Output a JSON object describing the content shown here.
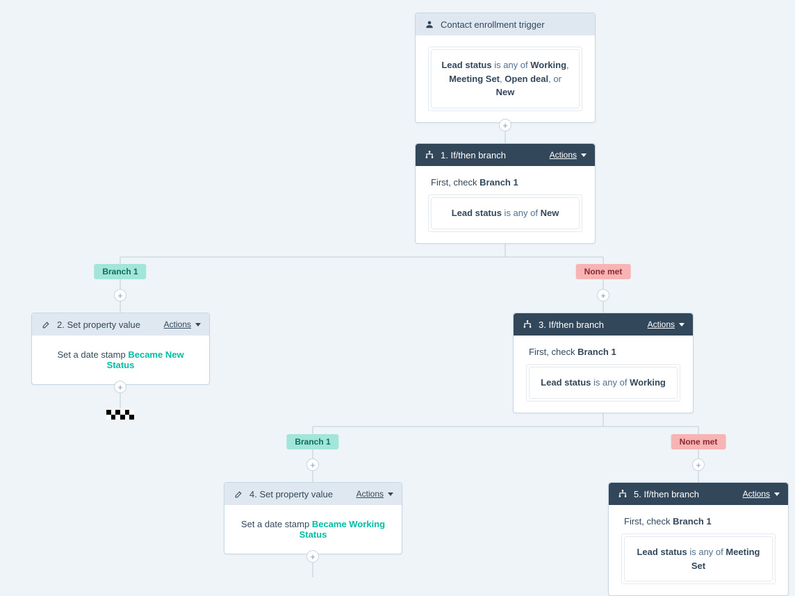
{
  "actions_label": "Actions",
  "trigger": {
    "title": "Contact enrollment trigger",
    "prop": "Lead status",
    "mid": " is any of ",
    "v1": "Working",
    "c1": ", ",
    "v2": "Meeting Set",
    "c2": ", ",
    "v3": "Open deal",
    "c3": ", or ",
    "v4": "New"
  },
  "branch1_label": "Branch 1",
  "none_met_label": "None met",
  "first_check_pre": "First, check ",
  "first_check_b": "Branch 1",
  "node1": {
    "title": "1. If/then branch",
    "prop": "Lead status",
    "mid": " is any of ",
    "val": "New"
  },
  "node2": {
    "title": "2. Set property value",
    "pre": "Set a date stamp ",
    "link": "Became New Status"
  },
  "node3": {
    "title": "3. If/then branch",
    "prop": "Lead status",
    "mid": " is any of ",
    "val": "Working"
  },
  "node4": {
    "title": "4. Set property value",
    "pre": "Set a date stamp ",
    "link": "Became Working Status"
  },
  "node5": {
    "title": "5. If/then branch",
    "prop": "Lead status",
    "mid": " is any of ",
    "val": "Meeting Set"
  }
}
